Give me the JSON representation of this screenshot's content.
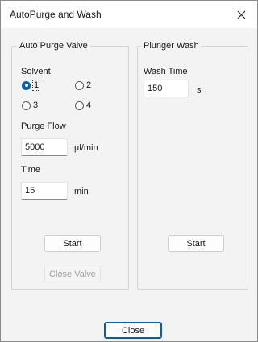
{
  "window": {
    "title": "AutoPurge and Wash"
  },
  "icons": {
    "close": "close-icon"
  },
  "auto_purge": {
    "group_label": "Auto Purge Valve",
    "solvent_label": "Solvent",
    "solvent_options": [
      {
        "label": "1",
        "checked": true
      },
      {
        "label": "2",
        "checked": false
      },
      {
        "label": "3",
        "checked": false
      },
      {
        "label": "4",
        "checked": false
      }
    ],
    "purge_flow_label": "Purge Flow",
    "purge_flow_value": "5000",
    "purge_flow_unit": "µl/min",
    "time_label": "Time",
    "time_value": "15",
    "time_unit": "min",
    "start_label": "Start",
    "close_valve_label": "Close Valve"
  },
  "plunger_wash": {
    "group_label": "Plunger Wash",
    "wash_time_label": "Wash Time",
    "wash_time_value": "150",
    "wash_time_unit": "s",
    "start_label": "Start"
  },
  "footer": {
    "close_label": "Close"
  },
  "colors": {
    "accent": "#005fb8",
    "dialog_bg": "#f3f3f3"
  }
}
